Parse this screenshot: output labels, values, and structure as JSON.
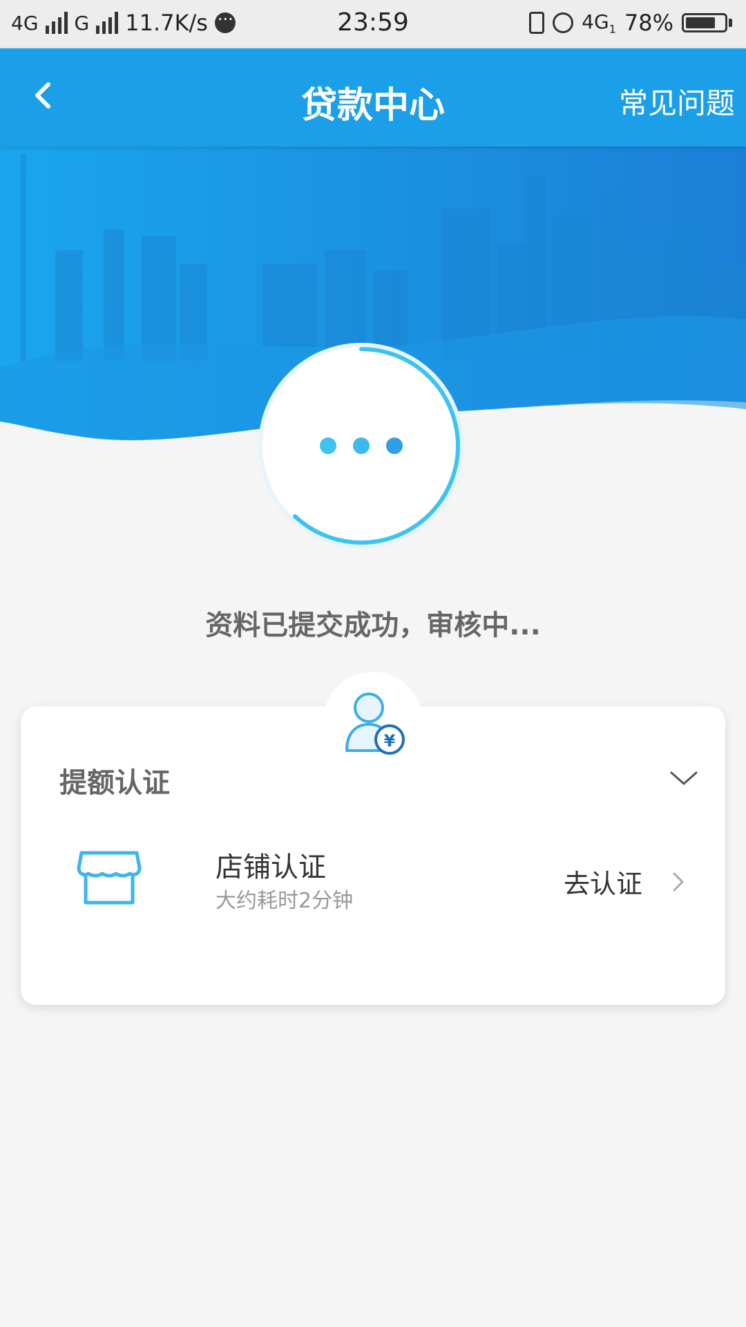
{
  "status_bar": {
    "network1": "4G",
    "network2": "G",
    "speed": "11.7K/s",
    "time": "23:59",
    "network3": "4G",
    "network3_sub": "1",
    "battery": "78%",
    "battery_level": 0.78
  },
  "header": {
    "title": "贷款中心",
    "faq_label": "常见问题",
    "back_icon": "chevron-left-icon",
    "bg_color": "#1a9fe8"
  },
  "review": {
    "status_text": "资料已提交成功，审核中...",
    "progress_fraction": 0.62
  },
  "card": {
    "title": "提额认证",
    "badge_icon": "user-yuan-icon",
    "items": [
      {
        "title": "店铺认证",
        "subtitle": "大约耗时2分钟",
        "action_label": "去认证",
        "icon": "shop-icon"
      }
    ]
  },
  "colors": {
    "accent": "#1a9fe8",
    "progress": "#3cc3f0",
    "background": "#f5f5f5"
  }
}
